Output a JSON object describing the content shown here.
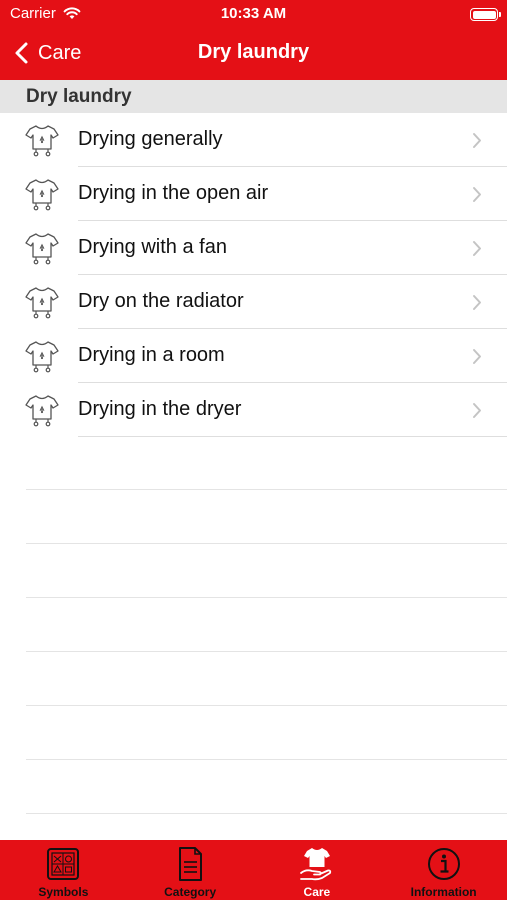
{
  "status_bar": {
    "carrier": "Carrier",
    "time": "10:33 AM"
  },
  "nav": {
    "back_label": "Care",
    "title": "Dry laundry"
  },
  "section": {
    "title": "Dry laundry"
  },
  "items": [
    {
      "label": "Drying generally"
    },
    {
      "label": "Drying in the open air"
    },
    {
      "label": "Drying with a fan"
    },
    {
      "label": "Dry on the radiator"
    },
    {
      "label": "Drying in a room"
    },
    {
      "label": "Drying in the dryer"
    }
  ],
  "tabs": [
    {
      "label": "Symbols",
      "icon": "symbols-grid-icon",
      "active": false
    },
    {
      "label": "Category",
      "icon": "document-icon",
      "active": false
    },
    {
      "label": "Care",
      "icon": "shirt-hand-icon",
      "active": true
    },
    {
      "label": "Information",
      "icon": "info-icon",
      "active": false
    }
  ],
  "colors": {
    "accent": "#e41016",
    "section_bg": "#e5e5e5",
    "active_tab_label": "#ffffff"
  }
}
